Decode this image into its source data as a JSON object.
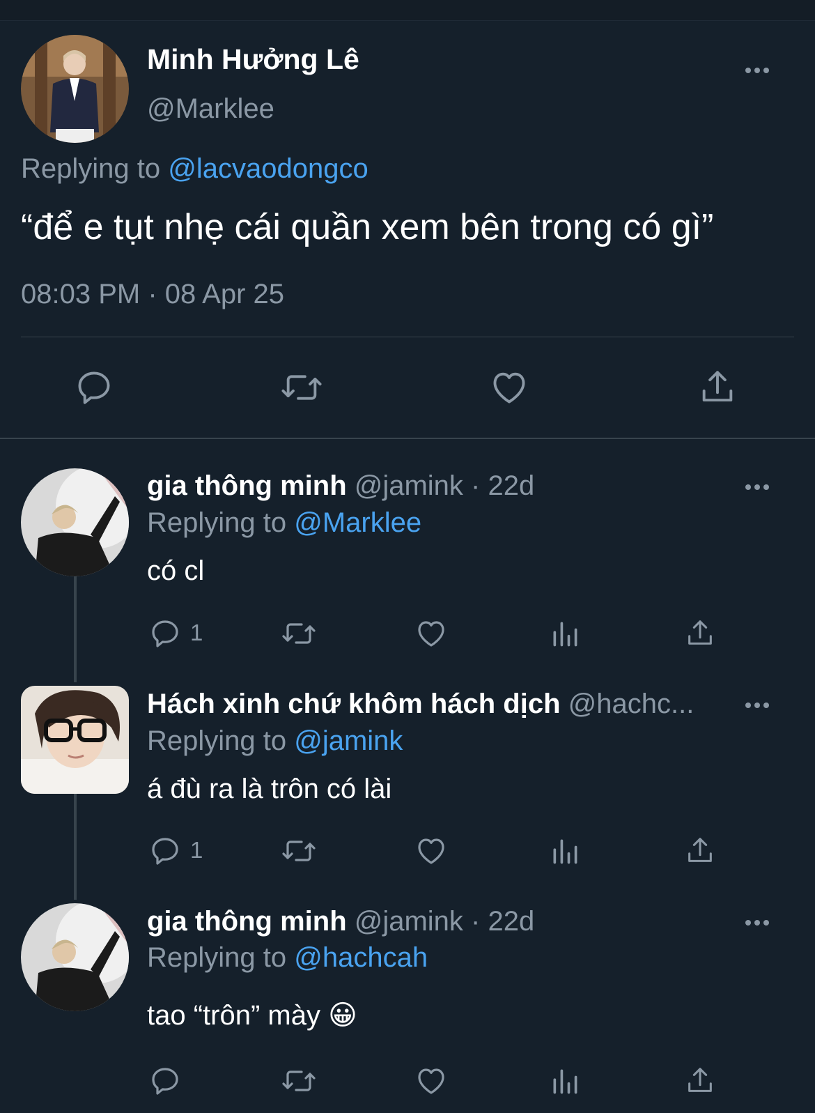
{
  "main_tweet": {
    "author_name": "Minh Hưởng Lê",
    "handle": "@Marklee",
    "replying_prefix": "Replying to ",
    "replying_to": "@lacvaodongco",
    "text": "“để e tụt nhẹ cái quần xem bên trong có gì”",
    "timestamp": "08:03 PM · 08 Apr 25",
    "actions": [
      "reply-icon",
      "retweet-icon",
      "like-icon",
      "share-icon"
    ]
  },
  "replies": [
    {
      "author_name": "gia thông minh",
      "meta": " @jamink · 22d",
      "replying_prefix": "Replying to ",
      "replying_to": "@Marklee",
      "text": "có cl",
      "reply_count": "1"
    },
    {
      "author_name": "Hách xinh chứ khôm hách dịch",
      "meta": " @hachc...",
      "replying_prefix": "Replying to ",
      "replying_to": "@jamink",
      "text": "á đù ra là trôn có lài",
      "reply_count": "1"
    },
    {
      "author_name": "gia thông minh",
      "meta": " @jamink · 22d",
      "replying_prefix": "Replying to ",
      "replying_to": "@hachcah",
      "text": "tao “trôn” mày 😀",
      "reply_count": ""
    }
  ],
  "colors": {
    "background": "#15202b",
    "secondary_text": "#8b98a5",
    "link": "#4aa3f0",
    "divider": "#38444d"
  }
}
